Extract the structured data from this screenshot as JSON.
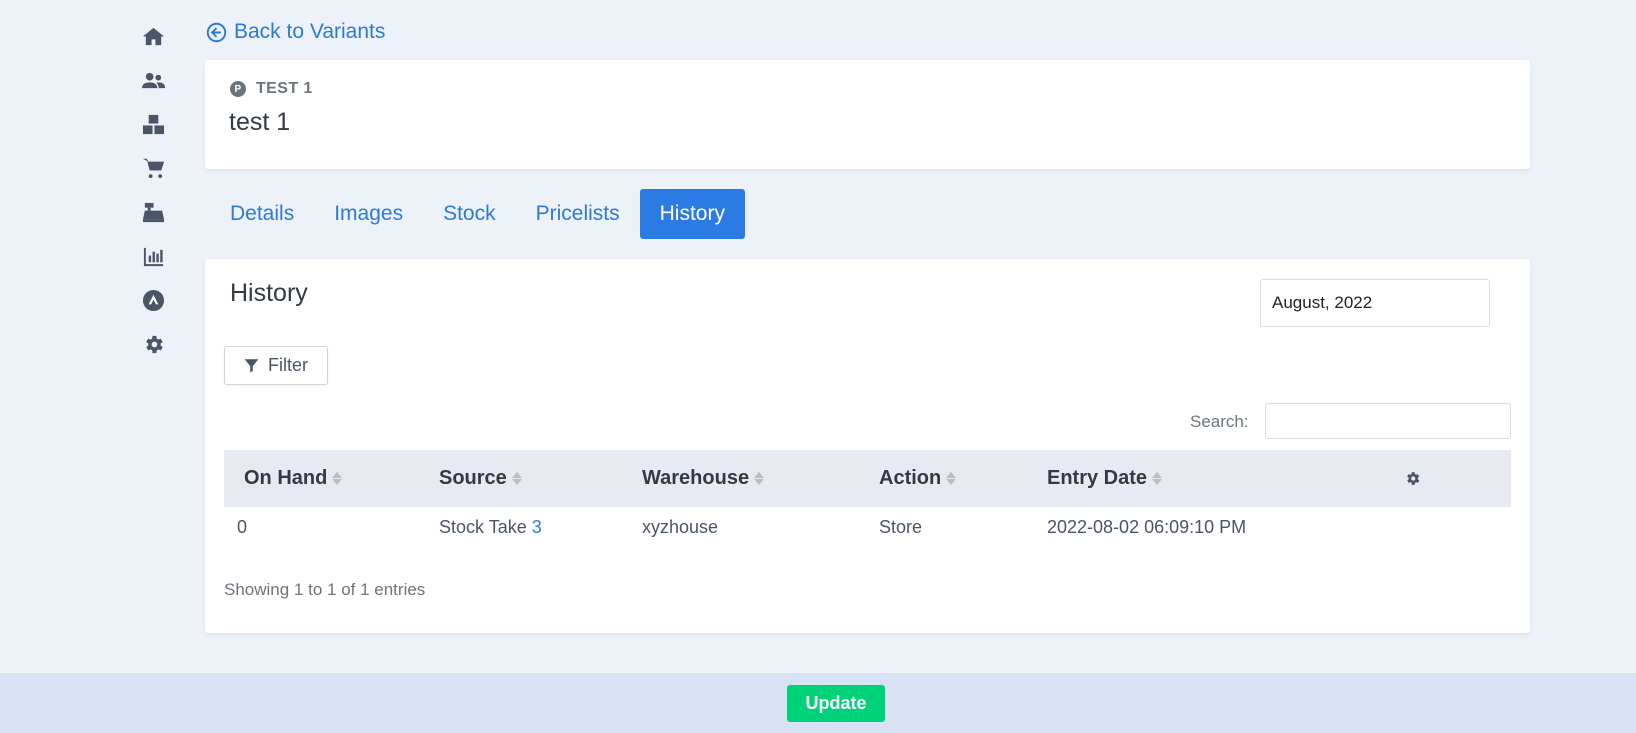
{
  "nav": {
    "back_label": "Back to Variants",
    "icons": [
      "home-icon",
      "users-icon",
      "boxes-icon",
      "cart-icon",
      "cash-register-icon",
      "chart-icon",
      "app-store-icon",
      "gear-icon"
    ]
  },
  "product": {
    "badge": "P",
    "code": "TEST 1",
    "name": "test 1"
  },
  "tabs": [
    {
      "label": "Details",
      "active": false
    },
    {
      "label": "Images",
      "active": false
    },
    {
      "label": "Stock",
      "active": false
    },
    {
      "label": "Pricelists",
      "active": false
    },
    {
      "label": "History",
      "active": true
    }
  ],
  "history": {
    "title": "History",
    "month": "August, 2022",
    "filter_label": "Filter",
    "search_label": "Search:",
    "search_value": "",
    "columns": [
      "On Hand",
      "Source",
      "Warehouse",
      "Action",
      "Entry Date"
    ],
    "rows": [
      {
        "on_hand": "0",
        "source_text": "Stock Take",
        "source_link": "3",
        "warehouse": "xyzhouse",
        "action": "Store",
        "entry_date": "2022-08-02 06:09:10 PM"
      }
    ],
    "entries_text": "Showing 1 to 1 of 1 entries"
  },
  "footer": {
    "update_label": "Update"
  },
  "colors": {
    "accent": "#2c7be5",
    "link": "#2d7ad6",
    "success": "#00d27a",
    "background": "#edf1f8",
    "footer": "#d8e2f5"
  }
}
